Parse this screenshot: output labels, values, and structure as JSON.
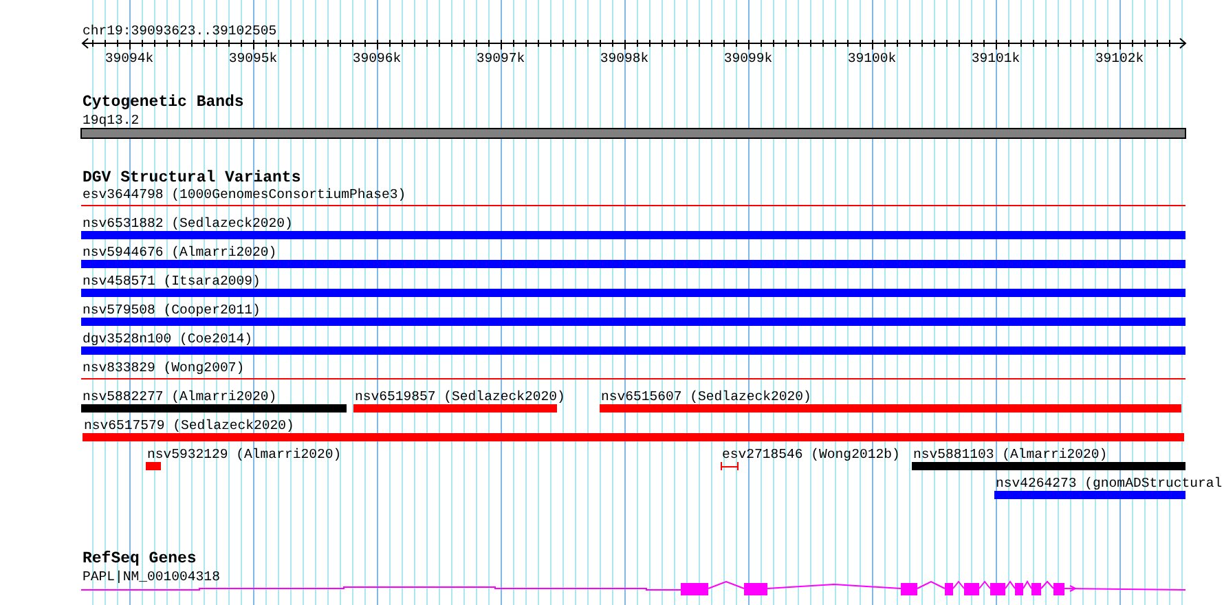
{
  "ruler": {
    "label": "chr19:39093623..39102505",
    "ticks": [
      "39094k",
      "39095k",
      "39096k",
      "39097k",
      "39098k",
      "39099k",
      "39100k",
      "39101k",
      "39102k"
    ]
  },
  "tracks": [
    {
      "title": "Cytogenetic Bands",
      "kind": "bands",
      "features": [
        {
          "label": "19q13.2",
          "color": "#808080"
        }
      ]
    },
    {
      "title": "DGV Structural Variants",
      "kind": "variants",
      "features": [
        {
          "label": "esv3644798 (1000GenomesConsortiumPhase3)",
          "kind": "line",
          "color": "#ff0000"
        },
        {
          "label": "nsv6531882 (Sedlazeck2020)",
          "kind": "bar",
          "color": "#0000ff"
        },
        {
          "label": "nsv5944676 (Almarri2020)",
          "kind": "bar",
          "color": "#0000ff"
        },
        {
          "label": "nsv458571 (Itsara2009)",
          "kind": "bar",
          "color": "#0000ff"
        },
        {
          "label": "nsv579508 (Cooper2011)",
          "kind": "bar",
          "color": "#0000ff"
        },
        {
          "label": "dgv3528n100 (Coe2014)",
          "kind": "bar",
          "color": "#0000ff"
        },
        {
          "label": "nsv833829 (Wong2007)",
          "kind": "line",
          "color": "#ff0000"
        },
        {
          "label": "nsv5882277 (Almarri2020)",
          "kind": "bar",
          "color": "#000000"
        },
        {
          "label": "nsv6519857 (Sedlazeck2020)",
          "kind": "bar",
          "color": "#ff0000"
        },
        {
          "label": "nsv6515607 (Sedlazeck2020)",
          "kind": "bar",
          "color": "#ff0000"
        },
        {
          "label": "nsv6517579 (Sedlazeck2020)",
          "kind": "bar",
          "color": "#ff0000"
        },
        {
          "label": "nsv5932129 (Almarri2020)",
          "kind": "bar",
          "color": "#ff0000"
        },
        {
          "label": "esv2718546 (Wong2012b)",
          "kind": "interval",
          "color": "#ff0000"
        },
        {
          "label": "nsv5881103 (Almarri2020)",
          "kind": "bar",
          "color": "#000000"
        },
        {
          "label": "nsv4264273 (gnomADStructural",
          "kind": "bar",
          "color": "#0000ff"
        }
      ]
    },
    {
      "title": "RefSeq Genes",
      "kind": "genes",
      "features": [
        {
          "label": "PAPL|NM_001004318",
          "color": "#ff00ff"
        }
      ]
    }
  ]
}
